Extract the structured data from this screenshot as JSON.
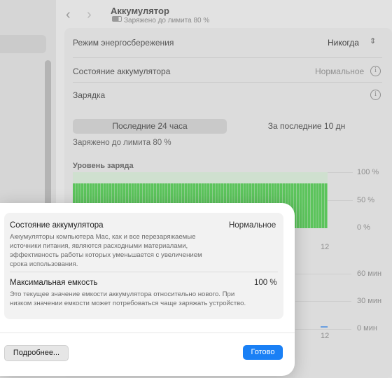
{
  "window": {
    "title": "Аккумулятор",
    "subtitle": "Заряжено до лимита 80 %"
  },
  "settings": {
    "power_mode_label": "Режим энергосбережения",
    "power_mode_value": "Никогда",
    "health_label": "Состояние аккумулятора",
    "health_value": "Нормальное",
    "charging_label": "Зарядка"
  },
  "tabs": [
    {
      "label": "Последние 24 часа",
      "selected": true
    },
    {
      "label": "За последние 10 дн",
      "selected": false
    }
  ],
  "charge_status": "Заряжено до лимита 80 %",
  "chart": {
    "title": "Уровень заряда",
    "y_ticks": [
      "100 %",
      "50 %",
      "0 %"
    ],
    "x_tick": "12",
    "usage_ticks": [
      "60 мин",
      "30 мин",
      "0 мин"
    ],
    "usage_x_tick": "12",
    "bar_color": "#5cc45c",
    "level_fraction": 0.8
  },
  "modal": {
    "health": {
      "title": "Состояние аккумулятора",
      "value": "Нормальное",
      "description": "Аккумуляторы компьютера Mac, как и все перезаряжаемые источники питания, являются расходными материалами, эффективность работы которых уменьшается с увеличением срока использования."
    },
    "capacity": {
      "title": "Максимальная емкость",
      "value": "100 %",
      "description": "Это текущее значение емкости аккумулятора относительно нового. При низком значении емкости может потребоваться чаще заряжать устройство."
    },
    "more_button": "Подробнее...",
    "done_button": "Готово",
    "accent": "#1a80f5"
  }
}
